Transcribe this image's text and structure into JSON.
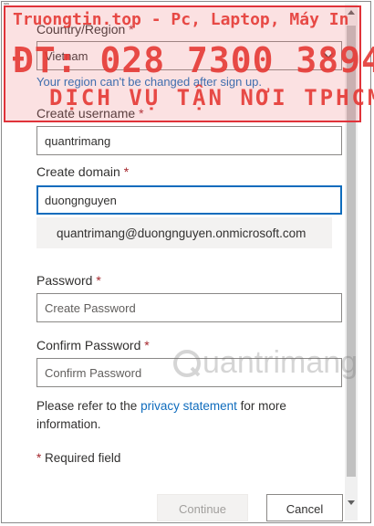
{
  "form": {
    "country_label": "Country/Region",
    "country_value": "Vietnam",
    "region_note": "Your region can't be changed after sign up.",
    "username_label": "Create username",
    "username_value": "quantrimang",
    "domain_label": "Create domain",
    "domain_value": "duongnguyen",
    "email_preview": "quantrimang@duongnguyen.onmicrosoft.com",
    "password_label": "Password",
    "password_placeholder": "Create Password",
    "confirm_label": "Confirm Password",
    "confirm_placeholder": "Confirm Password",
    "required_marker": "*",
    "privacy_prefix": "Please refer to the ",
    "privacy_link": "privacy statement",
    "privacy_suffix": " for more information.",
    "required_note": "Required field"
  },
  "buttons": {
    "next_label": "Continue",
    "cancel_label": "Cancel"
  },
  "watermark": {
    "line1": "Truongtin.top - Pc, Laptop, Máy In",
    "line2": "ĐT: 028 7300 3894",
    "line3": "DỊCH VỤ TẬN NƠI TPHCM",
    "logo_text": "uantrimang",
    "logo_color": "#e53935"
  },
  "colors": {
    "accent": "#0f6cbd",
    "required": "#a4262c"
  }
}
